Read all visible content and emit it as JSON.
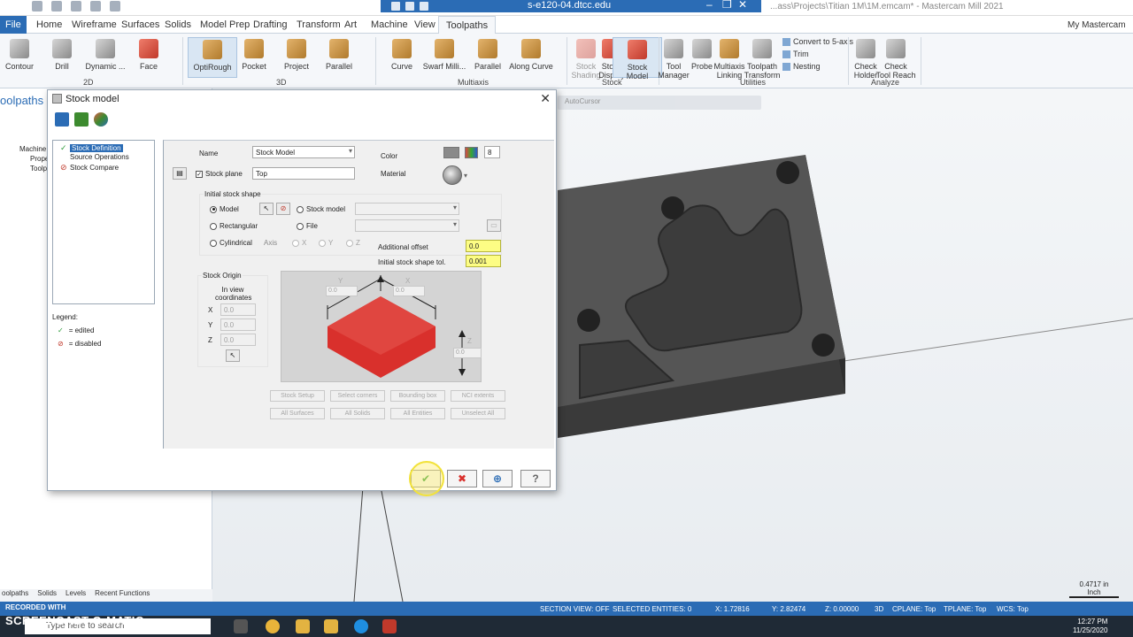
{
  "window": {
    "remote_host": "s-e120-04.dtcc.edu",
    "file_path": "...ass\\Projects\\Titian 1M\\1M.emcam* - Mastercam Mill 2021"
  },
  "ribbon_tabs": [
    "File",
    "Home",
    "Wireframe",
    "Surfaces",
    "Solids",
    "Model Prep",
    "Drafting",
    "Transform",
    "Art",
    "Machine",
    "View",
    "Toolpaths"
  ],
  "active_tab": "Toolpaths",
  "my_mastercam": "My Mastercam",
  "ribbon": {
    "buttons_2d": [
      "Contour",
      "Drill",
      "Dynamic ...",
      "Face"
    ],
    "buttons_3d": [
      "OptiRough",
      "Pocket",
      "Project",
      "Parallel"
    ],
    "buttons_multiaxis": [
      "Curve",
      "Swarf Milli...",
      "Parallel",
      "Along Curve"
    ],
    "buttons_stock": [
      [
        "Stock",
        "Shading"
      ],
      [
        "Stock",
        "Display"
      ],
      [
        "Stock",
        "Model"
      ]
    ],
    "buttons_utilities": [
      [
        "Tool",
        "Manager"
      ],
      [
        "Probe",
        ""
      ],
      [
        "Multiaxis",
        "Linking"
      ],
      [
        "Toolpath",
        "Transform"
      ]
    ],
    "utilities_small": [
      "Convert to 5-axis",
      "Trim",
      "Nesting"
    ],
    "buttons_analyze": [
      [
        "Check",
        "Holder"
      ],
      [
        "Check",
        "Tool Reach"
      ]
    ],
    "groups": {
      "g2d": "2D",
      "g3d": "3D",
      "multiaxis": "Multiaxis",
      "stock": "Stock",
      "utilities": "Utilities",
      "analyze": "Analyze"
    }
  },
  "left_panel": {
    "title": "oolpaths",
    "tree": [
      "Machine G",
      "Prope",
      "Toolp"
    ],
    "bottom_tabs": [
      "oolpaths",
      "Solids",
      "Levels",
      "Recent Functions"
    ]
  },
  "viewport": {
    "toolbar_label": "AutoCursor"
  },
  "dialog": {
    "title": "Stock model",
    "tree": [
      {
        "label": "Stock Definition",
        "state": "edited"
      },
      {
        "label": "Source Operations",
        "state": "none"
      },
      {
        "label": "Stock Compare",
        "state": "disabled"
      }
    ],
    "legend_title": "Legend:",
    "legend_edited": "= edited",
    "legend_disabled": "= disabled",
    "name_label": "Name",
    "name_value": "Stock Model",
    "color_label": "Color",
    "color_value": "8",
    "stock_plane_label": "Stock plane",
    "stock_plane_value": "Top",
    "material_label": "Material",
    "initial_shape_title": "Initial stock shape",
    "shape_model": "Model",
    "shape_stock_model": "Stock model",
    "shape_rectangular": "Rectangular",
    "shape_file": "File",
    "shape_cylindrical": "Cylindrical",
    "axis_label": "Axis",
    "axis_x": "X",
    "axis_y": "Y",
    "axis_z": "Z",
    "additional_offset_label": "Additional offset",
    "additional_offset_value": "0.0",
    "initial_tol_label": "Initial stock shape tol.",
    "initial_tol_value": "0.001",
    "origin_title": "Stock Origin",
    "origin_sub": "In view coordinates",
    "origin_x_label": "X",
    "origin_x": "0.0",
    "origin_y_label": "Y",
    "origin_y": "0.0",
    "origin_z_label": "Z",
    "origin_z": "0.0",
    "preview_y": "Y",
    "preview_x": "X",
    "preview_z": "Z",
    "preview_y_val": "0.0",
    "preview_x_val": "0.0",
    "preview_z_val": "0.0",
    "buttons_row1": [
      "Stock Setup",
      "Select corners",
      "Bounding box",
      "NCI extents"
    ],
    "buttons_row2": [
      "All Surfaces",
      "All Solids",
      "All Entities",
      "Unselect All"
    ]
  },
  "status": {
    "section_view": "SECTION VIEW: OFF",
    "selected": "SELECTED ENTITIES: 0",
    "x": "X:  1.72816",
    "y": "Y:  2.82474",
    "z": "Z:  0.00000",
    "mode": "3D",
    "cplane": "CPLANE: Top",
    "tplane": "TPLANE: Top",
    "wcs": "WCS: Top"
  },
  "scale": {
    "value": "0.4717 in",
    "unit": "Inch"
  },
  "taskbar": {
    "search": "Type here to search",
    "time": "12:27 PM",
    "date": "11/25/2020"
  },
  "recorder": {
    "line1": "RECORDED WITH",
    "line2": "SCREENCAST-O-MATIC"
  },
  "colors": {
    "accent": "#2b6cb5",
    "stock_red": "#d9302c",
    "part_dark": "#4a4a4a"
  }
}
